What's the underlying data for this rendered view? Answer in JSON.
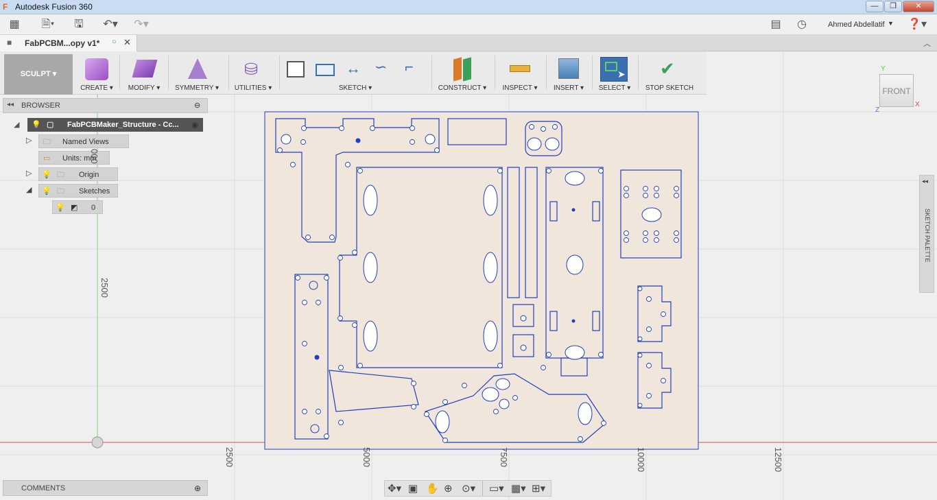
{
  "window": {
    "title": "Autodesk Fusion 360",
    "minimize": "—",
    "maximize": "❐",
    "close": "✕"
  },
  "user": {
    "name": "Ahmed Abdellatif"
  },
  "doc_tab": {
    "label": "FabPCBM...opy v1*"
  },
  "ribbon": {
    "workspace": "SCULPT",
    "groups": [
      {
        "label": "CREATE"
      },
      {
        "label": "MODIFY"
      },
      {
        "label": "SYMMETRY"
      },
      {
        "label": "UTILITIES"
      },
      {
        "label": "SKETCH"
      },
      {
        "label": "CONSTRUCT"
      },
      {
        "label": "INSPECT"
      },
      {
        "label": "INSERT"
      },
      {
        "label": "SELECT"
      },
      {
        "label": "STOP SKETCH"
      }
    ]
  },
  "browser": {
    "title": "BROWSER",
    "root": "FabPCBMaker_Structure - Cc...",
    "items": [
      {
        "label": "Named Views"
      },
      {
        "label": "Units: mm"
      },
      {
        "label": "Origin"
      },
      {
        "label": "Sketches"
      },
      {
        "label": "0"
      }
    ]
  },
  "comments": {
    "label": "COMMENTS"
  },
  "viewcube": {
    "face": "FRONT",
    "axis_y": "Y",
    "axis_x": "X",
    "axis_z": "Z"
  },
  "sketch_palette": {
    "label": "SKETCH PALETTE"
  },
  "axis_labels": {
    "v_top": "000",
    "v_2500": "2500",
    "h": [
      "2500",
      "5000",
      "7500",
      "10000",
      "12500"
    ]
  },
  "colors": {
    "sketch_line": "#1f3fbf",
    "sheet_fill": "#f1e6dc",
    "x_axis": "#e04848",
    "y_axis": "#5ec45e",
    "select_active": "#3a6fb0"
  }
}
